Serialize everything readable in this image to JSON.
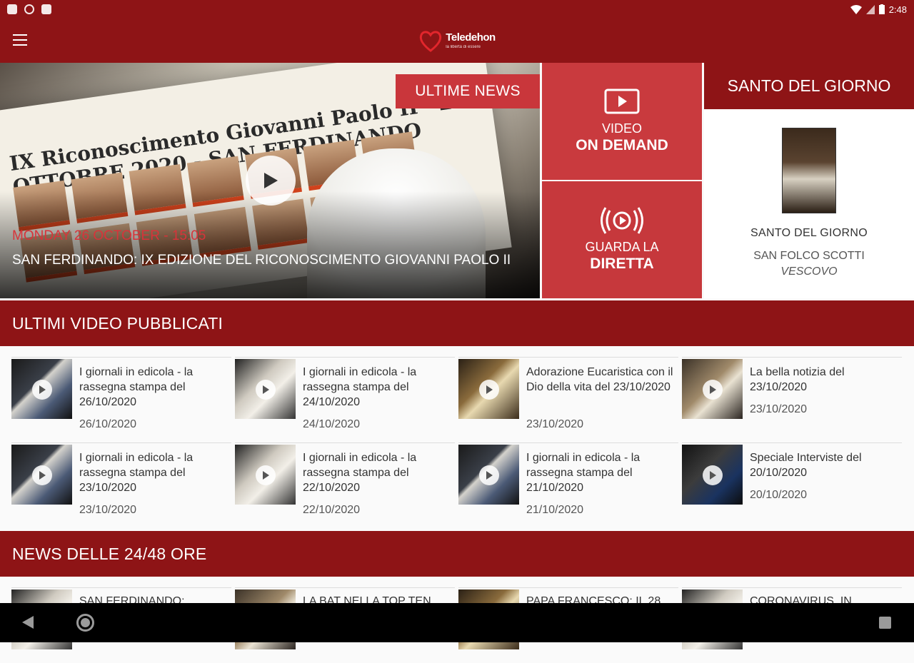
{
  "status": {
    "time": "2:48"
  },
  "app": {
    "brand": "Teledehon",
    "tagline": "la libertà di essere"
  },
  "hero": {
    "badge": "ULTIME NEWS",
    "board_text": "IX Riconoscimento Giovanni Paolo II · 24 OTTOBRE 2020 - SAN FERDINANDO",
    "date": "MONDAY 26 OCTOBER - 15:05",
    "title": "SAN FERDINANDO: IX EDIZIONE DEL RICONOSCIMENTO GIOVANNI PAOLO II"
  },
  "tiles": {
    "vod": {
      "line1": "VIDEO",
      "line2": "ON DEMAND"
    },
    "live": {
      "line1": "GUARDA LA",
      "line2": "DIRETTA"
    }
  },
  "saint": {
    "header": "SANTO DEL GIORNO",
    "label": "SANTO DEL GIORNO",
    "name": "SAN FOLCO SCOTTI",
    "role": "VESCOVO"
  },
  "sections": {
    "videos": "ULTIMI VIDEO PUBBLICATI",
    "news": "NEWS DELLE 24/48 ORE"
  },
  "videos": [
    {
      "title": "I giornali in edicola - la rassegna stampa del 26/10/2020",
      "date": "26/10/2020"
    },
    {
      "title": "I giornali in edicola - la rassegna stampa del 24/10/2020",
      "date": "24/10/2020"
    },
    {
      "title": "Adorazione Eucaristica con il Dio della vita del 23/10/2020",
      "date": "23/10/2020"
    },
    {
      "title": "La bella notizia del 23/10/2020",
      "date": "23/10/2020"
    },
    {
      "title": "I giornali in edicola - la rassegna stampa del 23/10/2020",
      "date": "23/10/2020"
    },
    {
      "title": "I giornali in edicola - la rassegna stampa del 22/10/2020",
      "date": "22/10/2020"
    },
    {
      "title": "I giornali in edicola - la rassegna stampa del 21/10/2020",
      "date": "21/10/2020"
    },
    {
      "title": "Speciale Interviste del 20/10/2020",
      "date": "20/10/2020"
    }
  ],
  "news": [
    {
      "title": "SAN FERDINANDO:"
    },
    {
      "title": "LA BAT NELLA TOP TEN"
    },
    {
      "title": "PAPA FRANCESCO: IL 28"
    },
    {
      "title": "CORONAVIRUS, IN"
    }
  ],
  "colors": {
    "primary": "#8e1416",
    "accent": "#c93a3e",
    "date_red": "#d8333a"
  }
}
